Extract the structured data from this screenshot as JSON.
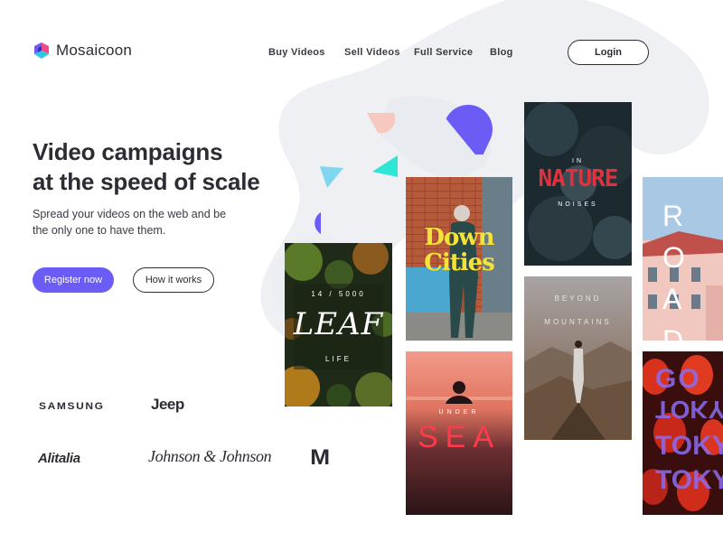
{
  "brand": {
    "name": "Mosaicoon",
    "logo_icon": "mosaic-cube-icon"
  },
  "nav": {
    "items": [
      {
        "label": "Buy Videos"
      },
      {
        "label": "Sell Videos"
      },
      {
        "label": "Full Service"
      },
      {
        "label": "Blog"
      }
    ],
    "login_label": "Login"
  },
  "hero": {
    "headline_lines": [
      "Video campaigns",
      "at the speed of scale"
    ],
    "subtitle_lines": [
      "Spread your videos on the web and be",
      "the only one to have them."
    ],
    "primary_cta": "Register now",
    "secondary_cta": "How it works"
  },
  "clients": [
    "SAMSUNG",
    "Jeep",
    "Alitalia",
    "Johnson & Johnson",
    "M"
  ],
  "cards": {
    "leaf": {
      "top": "14 / 5000",
      "title": "LEAF",
      "bottom": "LIFE"
    },
    "cities": {
      "line1": "Down",
      "line2": "Cities"
    },
    "nature": {
      "top": "IN",
      "title": "NATURE",
      "bottom": "NOISES"
    },
    "mountains": {
      "line1": "BEYOND",
      "line2": "MOUNTAINS"
    },
    "sea": {
      "top": "UNDER",
      "title": "SEA"
    },
    "roads": {
      "title": "ROADS"
    },
    "tokyo": {
      "title": "GO",
      "line2": "TOKYO",
      "mirror": "TOKYO"
    }
  },
  "colors": {
    "accent": "#6b5cf6",
    "text": "#2c2c35",
    "confetti_purple": "#6b5cf6",
    "confetti_cyan": "#2ee6d6",
    "confetti_lightblue": "#7fd6f0",
    "confetti_pink": "#f7c8c0",
    "nature_red": "#e0323e",
    "cities_yellow": "#f5e33a",
    "tokyo_purple": "#8c6cf0"
  }
}
